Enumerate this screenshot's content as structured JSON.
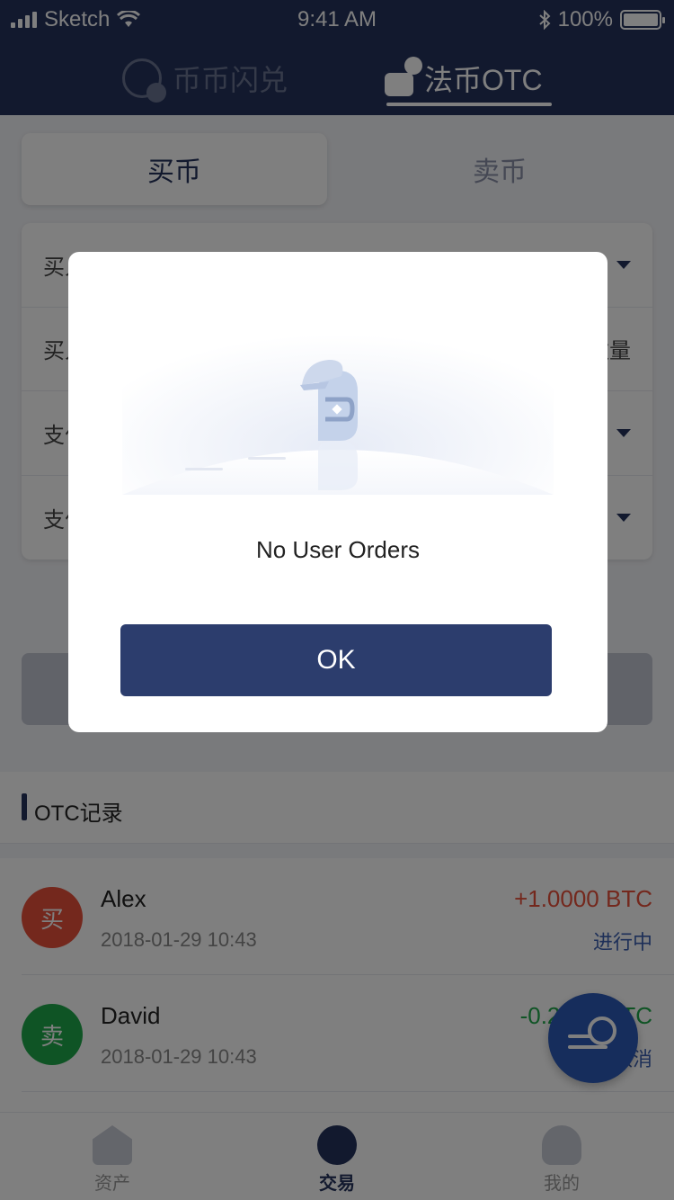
{
  "status_bar": {
    "carrier": "Sketch",
    "time": "9:41 AM",
    "battery": "100%"
  },
  "header": {
    "tabs": [
      {
        "label": "币币闪兑",
        "icon": "coin-swap-icon"
      },
      {
        "label": "法币OTC",
        "icon": "fiat-cash-icon"
      }
    ],
    "active_tab": 1
  },
  "trade": {
    "segments": [
      "买币",
      "卖币"
    ],
    "form_rows": [
      {
        "label": "买入币种",
        "type": "select"
      },
      {
        "label": "买入数量",
        "unit": "数量",
        "type": "input"
      },
      {
        "label": "支付币种",
        "type": "select"
      },
      {
        "label": "支付方式",
        "type": "select"
      }
    ]
  },
  "records": {
    "title": "OTC记录",
    "items": [
      {
        "badge": "买",
        "name": "Alex",
        "date": "2018-01-29 10:43",
        "amount": "+1.0000 BTC",
        "status": "进行中",
        "badge_color": "#e8503a",
        "amount_color": "#e8503a"
      },
      {
        "badge": "卖",
        "name": "David",
        "date": "2018-01-29 10:43",
        "amount": "-0.2100 BTC",
        "status": "已取消",
        "badge_color": "#1fa84a",
        "amount_color": "#1fa84a"
      }
    ]
  },
  "bottom_nav": {
    "items": [
      {
        "label": "资产",
        "icon": "wallet-icon"
      },
      {
        "label": "交易",
        "icon": "trade-icon"
      },
      {
        "label": "我的",
        "icon": "user-icon"
      }
    ],
    "active": 1
  },
  "modal": {
    "message": "No User Orders",
    "ok_label": "OK",
    "illustration": "empty-orders-illustration"
  },
  "colors": {
    "brand": "#25335d",
    "button": "#2c3d6d",
    "buy": "#e8503a",
    "sell": "#1fa84a"
  }
}
